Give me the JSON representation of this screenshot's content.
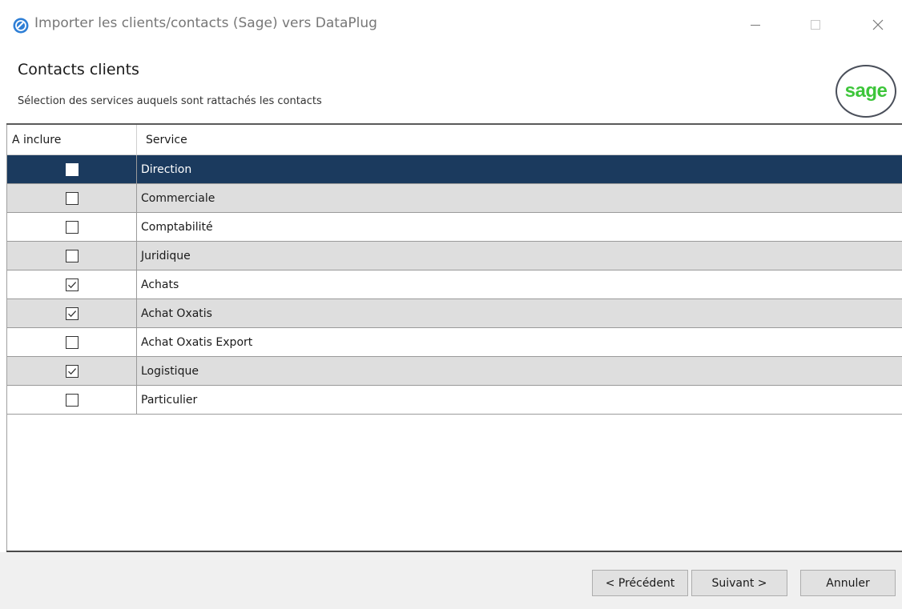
{
  "window": {
    "title": "Importer les clients/contacts (Sage) vers DataPlug",
    "icon": "dataplug-app-icon",
    "controls": [
      "minimize-icon",
      "maximize-icon",
      "close-icon"
    ]
  },
  "header": {
    "title": "Contacts clients",
    "subtitle": "Sélection des services auquels sont rattachés les contacts",
    "logo_text": "sage",
    "logo_color": "#3dc53a"
  },
  "grid": {
    "columns": [
      "A inclure",
      "Service"
    ],
    "selected_row_color": "#1b3a5e",
    "rows": [
      {
        "service": "Direction",
        "included": false
      },
      {
        "service": "Commerciale",
        "included": false
      },
      {
        "service": "Comptabilité",
        "included": false
      },
      {
        "service": "Juridique",
        "included": false
      },
      {
        "service": "Achats",
        "included": true
      },
      {
        "service": "Achat Oxatis",
        "included": true
      },
      {
        "service": "Achat Oxatis Export",
        "included": false
      },
      {
        "service": "Logistique",
        "included": true
      },
      {
        "service": "Particulier",
        "included": false
      }
    ]
  },
  "footer": {
    "prev_label": "< Précédent",
    "next_label": "Suivant >",
    "cancel_label": "Annuler"
  }
}
